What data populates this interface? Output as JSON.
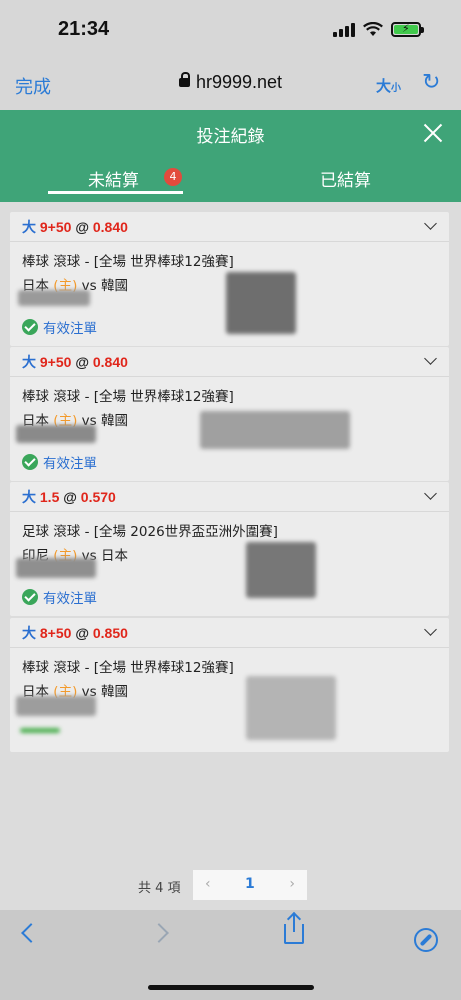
{
  "status": {
    "time": "21:34"
  },
  "browser": {
    "done_label": "完成",
    "url": "hr9999.net",
    "text_size_big": "大",
    "text_size_small": "小"
  },
  "modal": {
    "title": "投注紀錄"
  },
  "tabs": {
    "unsettled": "未結算",
    "badge": "4",
    "settled": "已結算"
  },
  "bets": [
    {
      "bet_type": "大",
      "handicap": "9+50",
      "at": "@",
      "odds": "0.840",
      "event": "棒球 滾球 - [全場 世界棒球12強賽]",
      "team1": "日本",
      "home_tag": "(主)",
      "vs": "vs",
      "team2": "韓國",
      "status": "有效注單"
    },
    {
      "bet_type": "大",
      "handicap": "9+50",
      "at": "@",
      "odds": "0.840",
      "event": "棒球 滾球 - [全場 世界棒球12強賽]",
      "team1": "日本",
      "home_tag": "(主)",
      "vs": "vs",
      "team2": "韓國",
      "status": "有效注單"
    },
    {
      "bet_type": "大",
      "handicap": "1.5",
      "at": "@",
      "odds": "0.570",
      "event": "足球 滾球 - [全場 2026世界盃亞洲外圍賽]",
      "team1": "印尼",
      "home_tag": "(主)",
      "vs": "vs",
      "team2": "日本",
      "status": "有效注單"
    },
    {
      "bet_type": "大",
      "handicap": "8+50",
      "at": "@",
      "odds": "0.850",
      "event": "棒球 滾球 - [全場 世界棒球12強賽]",
      "team1": "日本",
      "home_tag": "(主)",
      "vs": "vs",
      "team2": "韓國",
      "status": ""
    }
  ],
  "pagination": {
    "total": "共 4 項",
    "prev": "‹",
    "page": "1",
    "next": "›"
  },
  "colors": {
    "header_green": "#3fa478",
    "link_blue": "#2b7bd6",
    "odds_red": "#e0261b",
    "home_orange": "#f39a2b",
    "badge_red": "#e24b3d"
  }
}
